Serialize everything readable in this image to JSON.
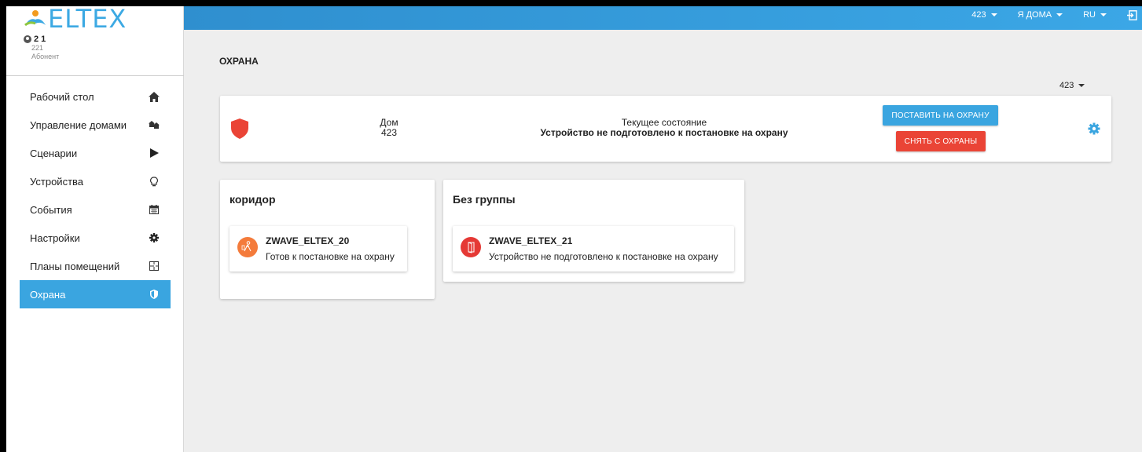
{
  "logo": {
    "text": "ELTEX",
    "color": "#3ca9e3"
  },
  "user": {
    "name": "2 1",
    "number": "221",
    "role": "Абонент"
  },
  "sidebar": {
    "items": [
      {
        "label": "Рабочий стол",
        "icon": "home-icon",
        "active": false
      },
      {
        "label": "Управление домами",
        "icon": "houses-icon",
        "active": false
      },
      {
        "label": "Сценарии",
        "icon": "play-icon",
        "active": false
      },
      {
        "label": "Устройства",
        "icon": "lightbulb-icon",
        "active": false
      },
      {
        "label": "События",
        "icon": "calendar-icon",
        "active": false
      },
      {
        "label": "Настройки",
        "icon": "gear-icon",
        "active": false
      },
      {
        "label": "Планы помещений",
        "icon": "floorplan-icon",
        "active": false
      },
      {
        "label": "Охрана",
        "icon": "shield-icon",
        "active": true
      }
    ]
  },
  "topbar": {
    "house": "423",
    "presence": "Я ДОМА",
    "language": "RU",
    "logout_icon": "logout-icon"
  },
  "page": {
    "title": "ОХРАНА",
    "house_select": "423"
  },
  "status": {
    "house_label": "Дом",
    "house_value": "423",
    "state_label": "Текущее состояние",
    "state_value": "Устройство не подготовлено к постановке на охрану",
    "arm_button": "ПОСТАВИТЬ НА ОХРАНУ",
    "disarm_button": "СНЯТЬ С ОХРАНЫ"
  },
  "groups": [
    {
      "title": "коридор",
      "device": {
        "name": "ZWAVE_ELTEX_20",
        "status": "Готов к постановке на охрану",
        "icon": "motion-sensor-icon",
        "color": "#f47b3b"
      }
    },
    {
      "title": "Без группы",
      "device": {
        "name": "ZWAVE_ELTEX_21",
        "status": "Устройство не подготовлено к постановке на охрану",
        "icon": "door-sensor-icon",
        "color": "#e53935"
      }
    }
  ],
  "colors": {
    "accent": "#3aa5e0",
    "danger": "#ea4436",
    "topbar": "#3ba7e6"
  }
}
